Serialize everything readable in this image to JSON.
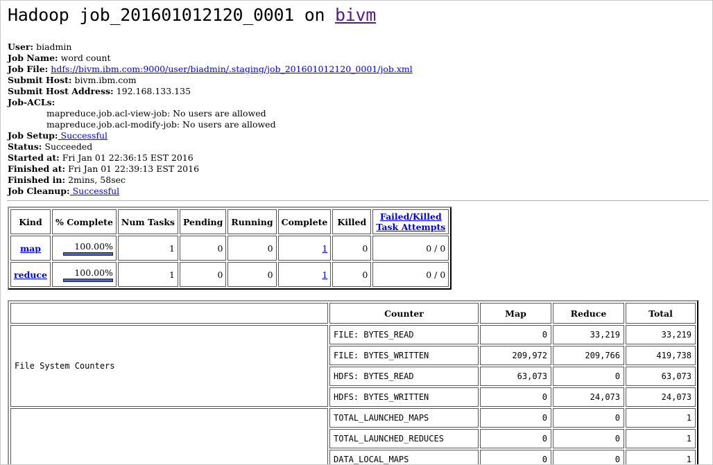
{
  "header": {
    "prefix": "Hadoop job_201601012120_0001 on ",
    "host_link": "bivm"
  },
  "info": {
    "user_label": "User:",
    "user": "biadmin",
    "job_name_label": "Job Name:",
    "job_name": "word count",
    "job_file_label": "Job File:",
    "job_file": "hdfs://bivm.ibm.com:9000/user/biadmin/.staging/job_201601012120_0001/job.xml",
    "submit_host_label": "Submit Host:",
    "submit_host": "bivm.ibm.com",
    "submit_addr_label": "Submit Host Address:",
    "submit_addr": "192.168.133.135",
    "acls_label": "Job-ACLs:",
    "acl_view": "mapreduce.job.acl-view-job: No users are allowed",
    "acl_modify": "mapreduce.job.acl-modify-job: No users are allowed",
    "setup_label": "Job Setup:",
    "setup": " Successful",
    "status_label": "Status:",
    "status": "Succeeded",
    "started_label": "Started at:",
    "started": "Fri Jan 01 22:36:15 EST 2016",
    "finished_label": "Finished at:",
    "finished": "Fri Jan 01 22:39:13 EST 2016",
    "finished_in_label": "Finished in:",
    "finished_in": "2mins, 58sec",
    "cleanup_label": "Job Cleanup:",
    "cleanup": " Successful"
  },
  "tasks": {
    "headers": [
      "Kind",
      "% Complete",
      "Num Tasks",
      "Pending",
      "Running",
      "Complete",
      "Killed",
      "Failed/Killed",
      "Task Attempts"
    ],
    "rows": [
      {
        "kind": "map",
        "pct": "100.00%",
        "progress": 1.0,
        "num": "1",
        "pending": "0",
        "running": "0",
        "complete": "1",
        "killed": "0",
        "failed": "0 / 0"
      },
      {
        "kind": "reduce",
        "pct": "100.00%",
        "progress": 1.0,
        "num": "1",
        "pending": "0",
        "running": "0",
        "complete": "1",
        "killed": "0",
        "failed": "0 / 0"
      }
    ]
  },
  "counters": {
    "headers": [
      "Counter",
      "Map",
      "Reduce",
      "Total"
    ],
    "group1": "File System Counters",
    "rows": [
      {
        "name": "FILE: BYTES_READ",
        "map": "0",
        "reduce": "33,219",
        "total": "33,219"
      },
      {
        "name": "FILE: BYTES_WRITTEN",
        "map": "209,972",
        "reduce": "209,766",
        "total": "419,738"
      },
      {
        "name": "HDFS: BYTES_READ",
        "map": "63,073",
        "reduce": "0",
        "total": "63,073"
      },
      {
        "name": "HDFS: BYTES_WRITTEN",
        "map": "0",
        "reduce": "24,073",
        "total": "24,073"
      },
      {
        "name": "TOTAL_LAUNCHED_MAPS",
        "map": "0",
        "reduce": "0",
        "total": "1"
      },
      {
        "name": "TOTAL_LAUNCHED_REDUCES",
        "map": "0",
        "reduce": "0",
        "total": "1"
      },
      {
        "name": "DATA_LOCAL_MAPS",
        "map": "0",
        "reduce": "0",
        "total": "1"
      }
    ]
  }
}
